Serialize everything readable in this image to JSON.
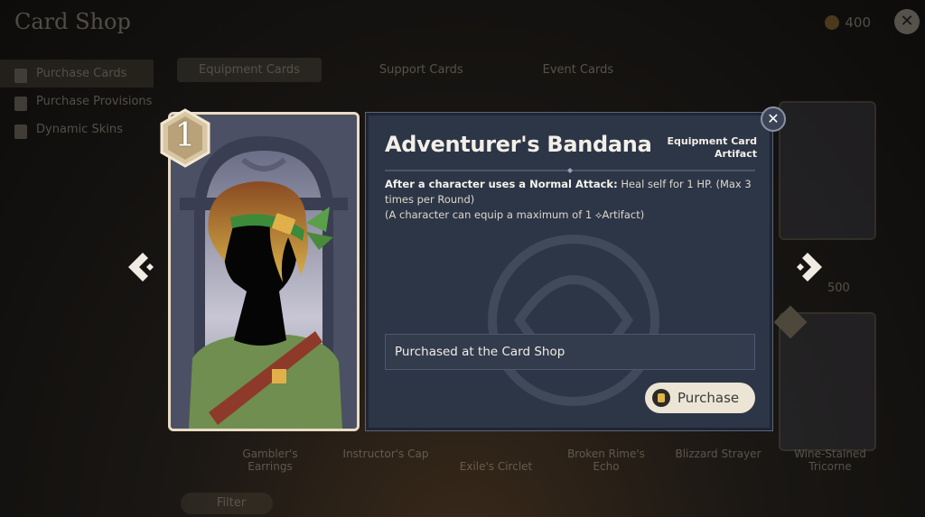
{
  "background": {
    "title": "Card Shop",
    "coin_amount": "400",
    "sidebar": [
      {
        "label": "Purchase Cards",
        "active": true
      },
      {
        "label": "Purchase Provisions",
        "active": false
      },
      {
        "label": "Dynamic Skins",
        "active": false
      }
    ],
    "tabs": [
      {
        "label": "Equipment Cards",
        "active": true
      },
      {
        "label": "Support Cards",
        "active": false
      },
      {
        "label": "Event Cards",
        "active": false
      }
    ],
    "card_names": [
      "Gambler's Earrings",
      "Instructor's Cap",
      "Exile's Circlet",
      "Broken Rime's Echo",
      "Blizzard Strayer",
      "Wine-Stained Tricorne"
    ],
    "card_price": "500",
    "filter_label": "Filter"
  },
  "card": {
    "cost": "1",
    "name": "Adventurer's Bandana",
    "type_line1": "Equipment Card",
    "type_line2": "Artifact",
    "desc_trigger": "After a character uses a Normal Attack:",
    "desc_effect": " Heal self for 1 HP. (Max 3 times per Round)",
    "desc_note": "(A character can equip a maximum of 1 ⟡Artifact)",
    "source": "Purchased at the Card Shop",
    "purchase_label": "Purchase"
  },
  "colors": {
    "panel_bg": "#2d3646",
    "card_border": "#e8dcc4",
    "button_bg": "#ece5d6",
    "bandana_green": "#5aa04a",
    "shirt_green": "#6f8e4f",
    "strap_red": "#8e3a2a"
  },
  "icons": {
    "prev": "chevron-left-diamond-icon",
    "next": "chevron-right-diamond-icon",
    "close": "close-icon",
    "coin": "coin-icon"
  }
}
